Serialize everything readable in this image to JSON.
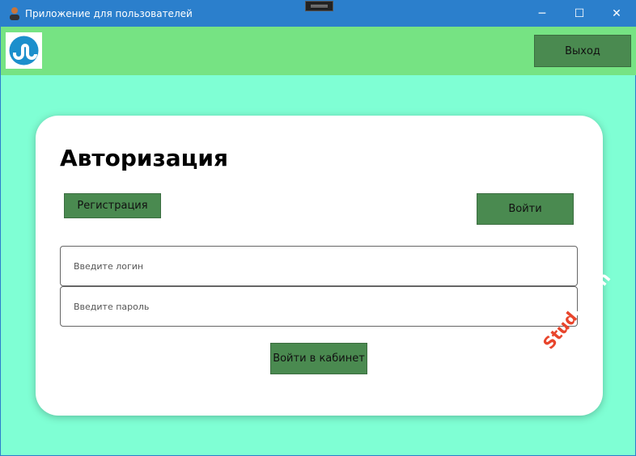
{
  "window": {
    "title": "Приложение для пользователей",
    "minimize": "─",
    "maximize": "☐",
    "close": "✕"
  },
  "header": {
    "logo_icon": "stumbleupon-logo",
    "exit_label": "Выход"
  },
  "auth": {
    "title": "Авторизация",
    "register_label": "Регистрация",
    "login_label": "Войти",
    "login_field": {
      "placeholder": "Введите логин",
      "value": ""
    },
    "password_field": {
      "placeholder": "Введите пароль",
      "value": ""
    },
    "enter_label": "Войти в кабинет"
  },
  "watermark": {
    "part1": "Stud",
    "part2": "Learn"
  },
  "colors": {
    "titlebar": "#2b7fcc",
    "header": "#76e383",
    "background": "#7fffd4",
    "button": "#4a8a50"
  }
}
